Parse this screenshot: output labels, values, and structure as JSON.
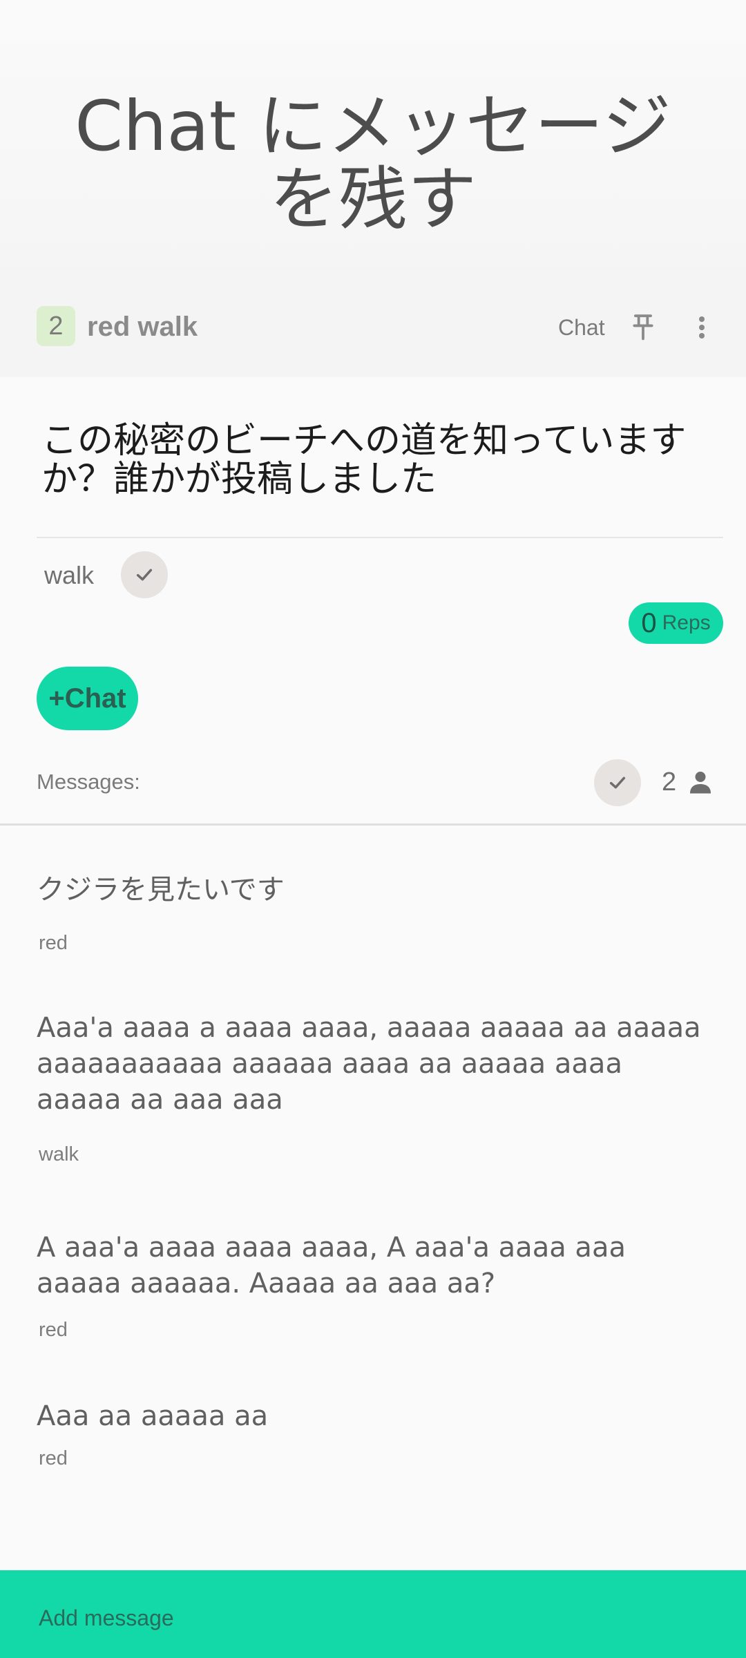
{
  "hero": {
    "title": "Chat にメッセージを残す"
  },
  "header": {
    "badge_count": "2",
    "title": "red walk",
    "chat_label": "Chat",
    "pin_icon": "pin-icon",
    "more_icon": "more-vertical-icon"
  },
  "post": {
    "question": "この秘密のビーチへの道を知っていますか？誰かが投稿しました",
    "tag_label": "walk",
    "tag_check_icon": "check-icon"
  },
  "reps": {
    "count": "0",
    "label": "Reps"
  },
  "actions": {
    "chat_button": "+Chat"
  },
  "messages_bar": {
    "label": "Messages:",
    "check_icon": "check-icon",
    "member_count": "2",
    "person_icon": "person-icon"
  },
  "messages": [
    {
      "text": "クジラを見たいです",
      "author": "red"
    },
    {
      "text": "Aaa'a aaaa a aaaa aaaa, aaaaa aaaaa aa aaaaa aaaaaaaaaaa aaaaaa aaaa aa aaaaa aaaa aaaaa aa aaa aaa",
      "author": "walk"
    },
    {
      "text": "A aaa'a aaaa aaaa aaaa, A aaa'a aaaa aaa aaaaa aaaaaa. Aaaaa aa aaa aa?",
      "author": "red"
    },
    {
      "text": "Aaa aa aaaaa aa",
      "author": "red"
    }
  ],
  "footer": {
    "input_placeholder": "Add message"
  },
  "colors": {
    "accent": "#13d8a8",
    "badge_bg": "#dcefcf",
    "check_bg": "#e6e3e0"
  }
}
